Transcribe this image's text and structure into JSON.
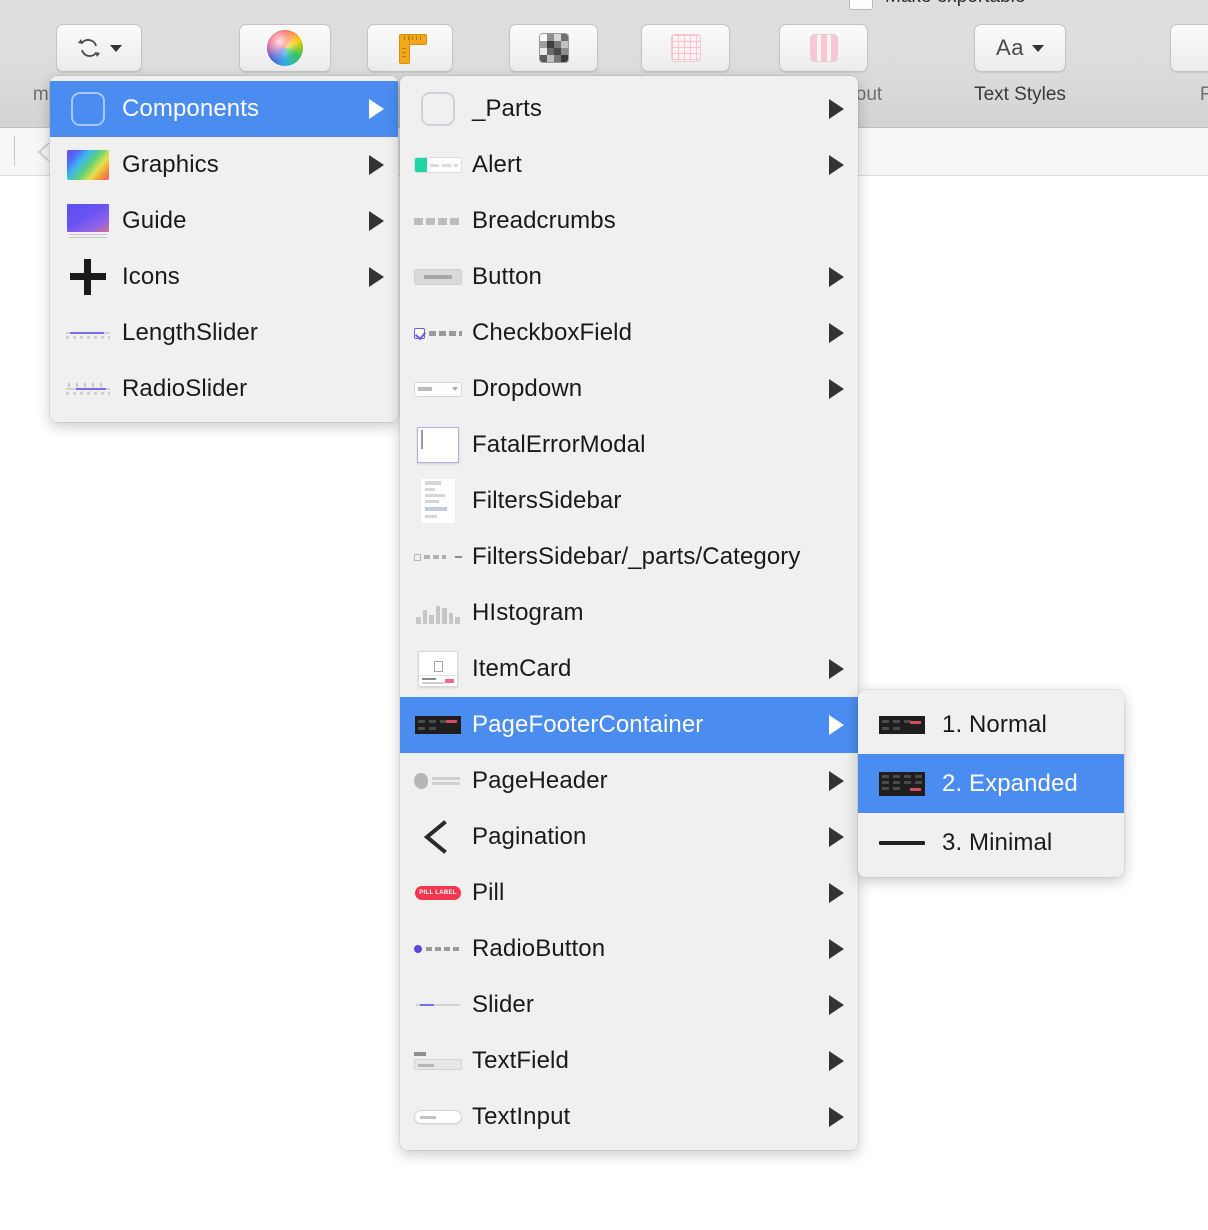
{
  "app": {
    "top_partial_text": "Make exportable",
    "left_partial_label": "mbol"
  },
  "toolbar": {
    "groups": [
      {
        "name": "rotate",
        "icon": "rotate-copies-icon",
        "label": ""
      },
      {
        "name": "color",
        "icon": "color-wheel-icon",
        "label": ""
      },
      {
        "name": "ruler",
        "icon": "ruler-icon",
        "label": ""
      },
      {
        "name": "grid-dark",
        "icon": "pixel-grid-icon",
        "label": ""
      },
      {
        "name": "grid-pink",
        "icon": "layout-grid-icon",
        "label": "out"
      },
      {
        "name": "columns-pink",
        "icon": "layout-columns-icon",
        "label": ""
      },
      {
        "name": "text-styles",
        "icon": "text-style-icon",
        "label": "Text Styles"
      },
      {
        "name": "format",
        "icon": "format-icon",
        "label": "Fo"
      }
    ],
    "text_styles_label": "Text Styles",
    "layout_label": "out",
    "format_label": "Fo",
    "aa_label": "Aa"
  },
  "menus": {
    "root": {
      "name": "symbol-library-menu",
      "items": [
        {
          "label": "Components",
          "icon": "rounded-square-thumb",
          "has_submenu": true,
          "selected": true
        },
        {
          "label": "Graphics",
          "icon": "gradient-thumb",
          "has_submenu": true,
          "selected": false
        },
        {
          "label": "Guide",
          "icon": "guide-thumb",
          "has_submenu": true,
          "selected": false
        },
        {
          "label": "Icons",
          "icon": "plus-thumb",
          "has_submenu": true,
          "selected": false
        },
        {
          "label": "LengthSlider",
          "icon": "slider-thumb",
          "has_submenu": false,
          "selected": false
        },
        {
          "label": "RadioSlider",
          "icon": "radioslider-thumb",
          "has_submenu": false,
          "selected": false
        }
      ]
    },
    "components": {
      "name": "components-submenu",
      "items": [
        {
          "label": "_Parts",
          "icon": "rounded-square-thumb",
          "has_submenu": true,
          "selected": false
        },
        {
          "label": "Alert",
          "icon": "alert-thumb",
          "has_submenu": true,
          "selected": false
        },
        {
          "label": "Breadcrumbs",
          "icon": "breadcrumbs-thumb",
          "has_submenu": false,
          "selected": false
        },
        {
          "label": "Button",
          "icon": "button-thumb",
          "has_submenu": true,
          "selected": false
        },
        {
          "label": "CheckboxField",
          "icon": "checkbox-thumb",
          "has_submenu": true,
          "selected": false
        },
        {
          "label": "Dropdown",
          "icon": "dropdown-thumb",
          "has_submenu": true,
          "selected": false
        },
        {
          "label": "FatalErrorModal",
          "icon": "modal-thumb",
          "has_submenu": false,
          "selected": false
        },
        {
          "label": "FiltersSidebar",
          "icon": "sidebar-thumb",
          "has_submenu": false,
          "selected": false
        },
        {
          "label": "FiltersSidebar/_parts/Category",
          "icon": "category-row-thumb",
          "has_submenu": false,
          "selected": false
        },
        {
          "label": "HIstogram",
          "icon": "histogram-thumb",
          "has_submenu": false,
          "selected": false
        },
        {
          "label": "ItemCard",
          "icon": "item-card-thumb",
          "has_submenu": true,
          "selected": false
        },
        {
          "label": "PageFooterContainer",
          "icon": "page-footer-thumb",
          "has_submenu": true,
          "selected": true
        },
        {
          "label": "PageHeader",
          "icon": "page-header-thumb",
          "has_submenu": true,
          "selected": false
        },
        {
          "label": "Pagination",
          "icon": "pagination-thumb",
          "has_submenu": true,
          "selected": false
        },
        {
          "label": "Pill",
          "icon": "pill-thumb",
          "has_submenu": true,
          "selected": false
        },
        {
          "label": "RadioButton",
          "icon": "radio-thumb",
          "has_submenu": true,
          "selected": false
        },
        {
          "label": "Slider",
          "icon": "slider-thumb",
          "has_submenu": true,
          "selected": false
        },
        {
          "label": "TextField",
          "icon": "textfield-thumb",
          "has_submenu": true,
          "selected": false
        },
        {
          "label": "TextInput",
          "icon": "textinput-thumb",
          "has_submenu": true,
          "selected": false
        }
      ]
    },
    "page_footer_variants": {
      "name": "page-footer-variants-submenu",
      "items": [
        {
          "label": "1. Normal",
          "icon": "footer-normal-thumb",
          "has_submenu": false,
          "selected": false
        },
        {
          "label": "2. Expanded",
          "icon": "footer-expanded-thumb",
          "has_submenu": false,
          "selected": true
        },
        {
          "label": "3. Minimal",
          "icon": "footer-minimal-thumb",
          "has_submenu": false,
          "selected": false
        }
      ]
    }
  },
  "pill_thumb_text": "PILL LABEL",
  "colors": {
    "selection_blue": "#4a8cf0",
    "menu_background": "#f0f0f0",
    "toolbar_background": "#dcdcdc",
    "text_primary": "#1a1a1a",
    "text_on_selection": "#ffffff",
    "accent_orange": "#f2a81d",
    "accent_pink": "#f7c3cf",
    "pill_red": "#f0374f"
  }
}
